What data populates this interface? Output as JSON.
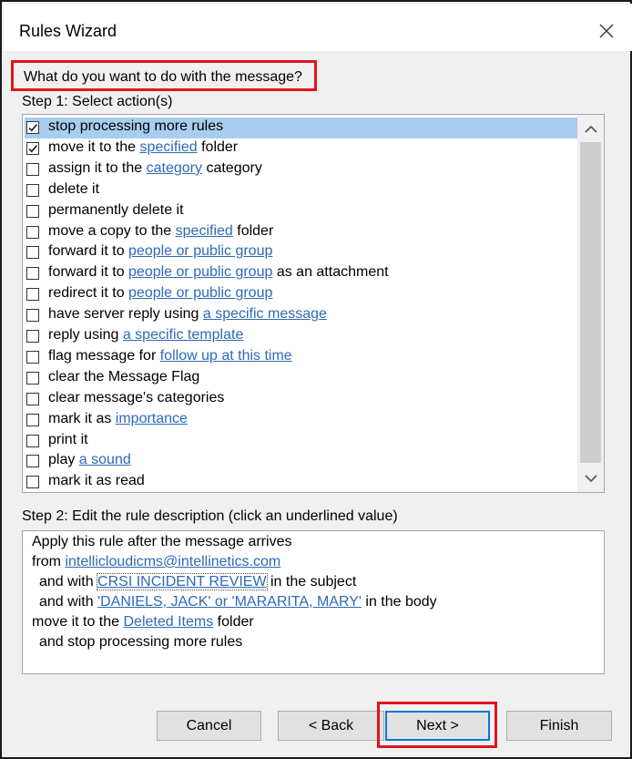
{
  "window": {
    "title": "Rules Wizard"
  },
  "heading": "What do you want to do with the message?",
  "step1_label": "Step 1: Select action(s)",
  "actions": [
    {
      "checked": true,
      "selected": true,
      "parts": [
        "stop processing more rules"
      ]
    },
    {
      "checked": true,
      "selected": false,
      "parts": [
        "move it to the ",
        {
          "link": "specified"
        },
        " folder"
      ]
    },
    {
      "checked": false,
      "selected": false,
      "parts": [
        "assign it to the ",
        {
          "link": "category"
        },
        " category"
      ]
    },
    {
      "checked": false,
      "selected": false,
      "parts": [
        "delete it"
      ]
    },
    {
      "checked": false,
      "selected": false,
      "parts": [
        "permanently delete it"
      ]
    },
    {
      "checked": false,
      "selected": false,
      "parts": [
        "move a copy to the ",
        {
          "link": "specified"
        },
        " folder"
      ]
    },
    {
      "checked": false,
      "selected": false,
      "parts": [
        "forward it to ",
        {
          "link": "people or public group"
        }
      ]
    },
    {
      "checked": false,
      "selected": false,
      "parts": [
        "forward it to ",
        {
          "link": "people or public group"
        },
        " as an attachment"
      ]
    },
    {
      "checked": false,
      "selected": false,
      "parts": [
        "redirect it to ",
        {
          "link": "people or public group"
        }
      ]
    },
    {
      "checked": false,
      "selected": false,
      "parts": [
        "have server reply using ",
        {
          "link": "a specific message"
        }
      ]
    },
    {
      "checked": false,
      "selected": false,
      "parts": [
        "reply using ",
        {
          "link": "a specific template"
        }
      ]
    },
    {
      "checked": false,
      "selected": false,
      "parts": [
        "flag message for ",
        {
          "link": "follow up at this time"
        }
      ]
    },
    {
      "checked": false,
      "selected": false,
      "parts": [
        "clear the Message Flag"
      ]
    },
    {
      "checked": false,
      "selected": false,
      "parts": [
        "clear message's categories"
      ]
    },
    {
      "checked": false,
      "selected": false,
      "parts": [
        "mark it as ",
        {
          "link": "importance"
        }
      ]
    },
    {
      "checked": false,
      "selected": false,
      "parts": [
        "print it"
      ]
    },
    {
      "checked": false,
      "selected": false,
      "parts": [
        "play ",
        {
          "link": "a sound"
        }
      ]
    },
    {
      "checked": false,
      "selected": false,
      "parts": [
        "mark it as read"
      ]
    }
  ],
  "step2_label": "Step 2: Edit the rule description (click an underlined value)",
  "description": [
    {
      "parts": [
        "Apply this rule after the message arrives"
      ]
    },
    {
      "parts": [
        "from ",
        {
          "link": "intellicloudicms@intellinetics.com"
        }
      ]
    },
    {
      "parts": [
        "  and with ",
        {
          "link": "CRSI INCIDENT REVIEW",
          "boxed": true
        },
        " in the subject"
      ]
    },
    {
      "parts": [
        "  and with ",
        {
          "link": "'DANIELS, JACK' or 'MARARITA, MARY'"
        },
        " in the body"
      ]
    },
    {
      "parts": [
        "move it to the ",
        {
          "link": "Deleted Items"
        },
        " folder"
      ]
    },
    {
      "parts": [
        "  and stop processing more rules"
      ]
    }
  ],
  "buttons": {
    "cancel": "Cancel",
    "back": "< Back",
    "next": "Next >",
    "finish": "Finish"
  },
  "colors": {
    "link": "#2d6ab6",
    "selection": "#a9cdef",
    "highlight_box": "#e0141e",
    "focus": "#0078d7"
  }
}
